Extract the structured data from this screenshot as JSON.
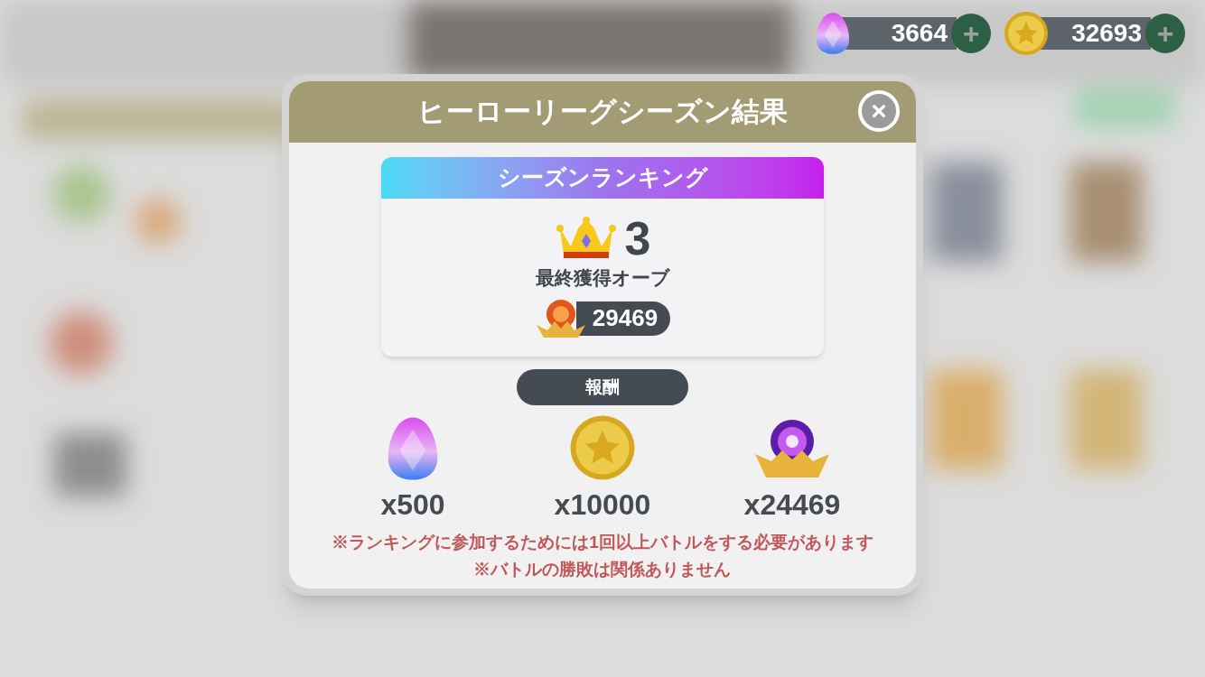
{
  "currencies": [
    {
      "kind": "gem",
      "amount": "3664",
      "add": "+"
    },
    {
      "kind": "coin",
      "amount": "32693",
      "add": "+"
    }
  ],
  "dialog": {
    "title": "ヒーローリーグシーズン結果",
    "close": "×",
    "ranking": {
      "title": "シーズンランキング",
      "rank": "3",
      "orb_label": "最終獲得オーブ",
      "orb_amount": "29469"
    },
    "rewards_title": "報酬",
    "rewards": [
      {
        "kind": "gem",
        "amount": "x500"
      },
      {
        "kind": "coin",
        "amount": "x10000"
      },
      {
        "kind": "orb",
        "amount": "x24469"
      }
    ],
    "notes": [
      "※ランキングに参加するためには1回以上バトルをする必要があります",
      "※バトルの勝敗は関係ありません"
    ]
  }
}
